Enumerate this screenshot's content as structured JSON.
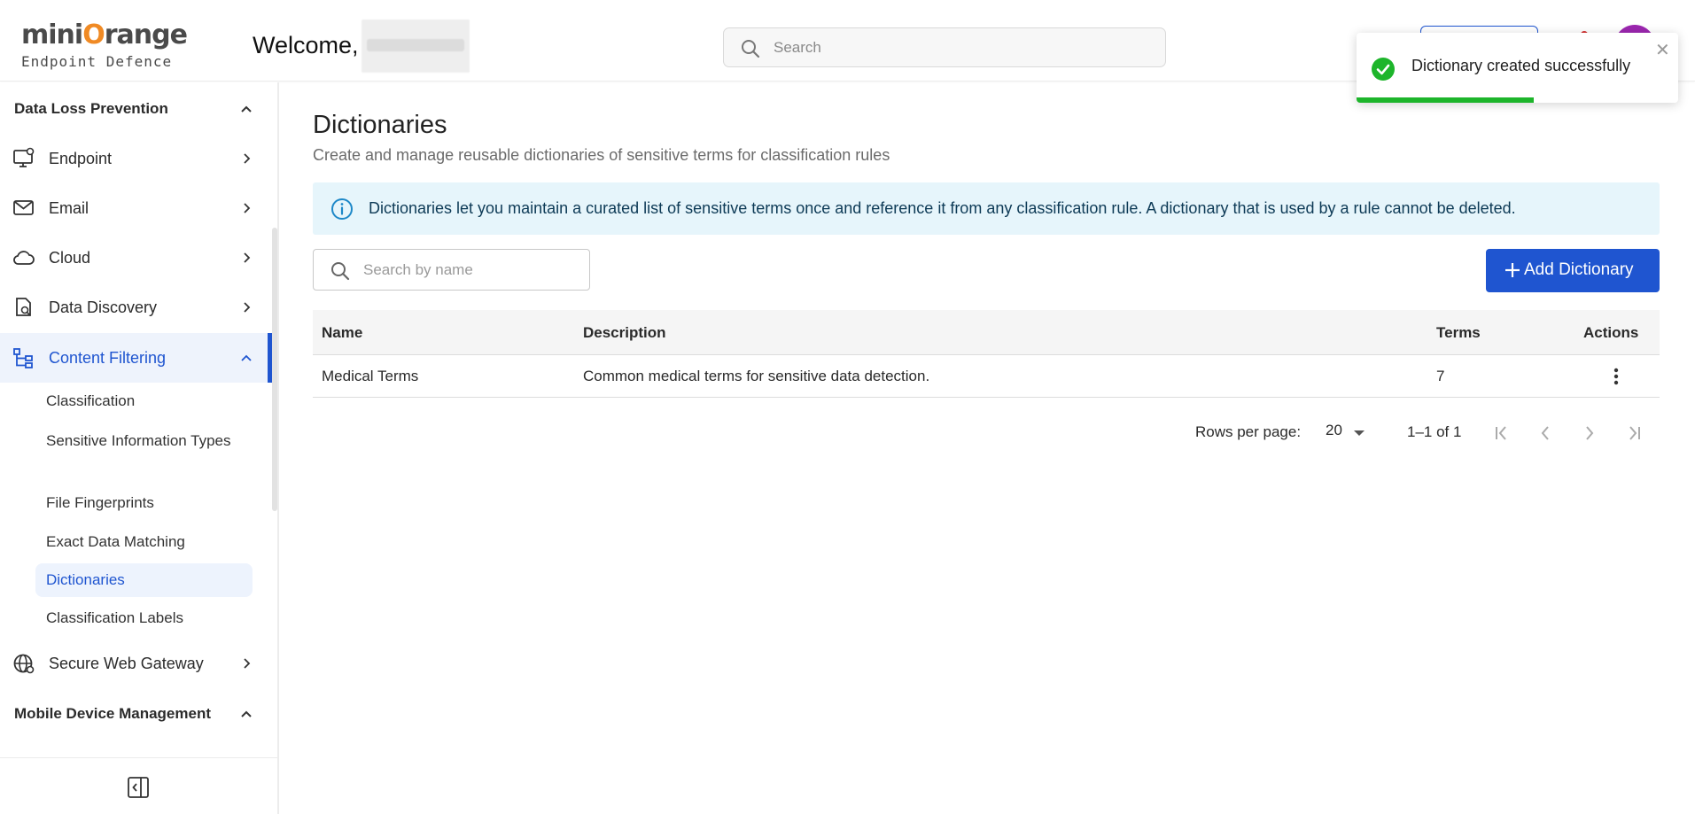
{
  "header": {
    "logo_main_prefix": "mini",
    "logo_main_o": "O",
    "logo_main_suffix": "range",
    "logo_sub": "Endpoint Defence",
    "welcome": "Welcome,",
    "search_placeholder": "Search"
  },
  "toast": {
    "message": "Dictionary created successfully",
    "progress_fraction": 0.55,
    "color": "#1db52b"
  },
  "sidebar": {
    "section_dlp": "Data Loss Prevention",
    "items": [
      {
        "label": "Endpoint",
        "icon": "monitor-icon"
      },
      {
        "label": "Email",
        "icon": "mail-icon"
      },
      {
        "label": "Cloud",
        "icon": "cloud-icon"
      },
      {
        "label": "Data Discovery",
        "icon": "file-search-icon"
      },
      {
        "label": "Content Filtering",
        "icon": "hierarchy-icon"
      }
    ],
    "sub_items": [
      "Classification",
      "Sensitive Information Types",
      "File Fingerprints",
      "Exact Data Matching",
      "Dictionaries",
      "Classification Labels"
    ],
    "secure_web_gateway": "Secure Web Gateway",
    "section_mdm": "Mobile Device Management"
  },
  "main": {
    "title": "Dictionaries",
    "subtitle": "Create and manage reusable dictionaries of sensitive terms for classification rules",
    "info_text": "Dictionaries let you maintain a curated list of sensitive terms once and reference it from any classification rule. A dictionary that is used by a rule cannot be deleted.",
    "search_placeholder": "Search by name",
    "add_button": "Add Dictionary",
    "table": {
      "columns": [
        "Name",
        "Description",
        "Terms",
        "Actions"
      ],
      "rows": [
        {
          "name": "Medical Terms",
          "description": "Common medical terms for sensitive data detection.",
          "terms": "7"
        }
      ]
    },
    "pagination": {
      "rows_per_page_label": "Rows per page:",
      "rows_per_page": "20",
      "range": "1–1 of 1"
    }
  },
  "colors": {
    "accent": "#1f55d0",
    "info_bg": "#e6f5fb",
    "success": "#1db52b"
  }
}
